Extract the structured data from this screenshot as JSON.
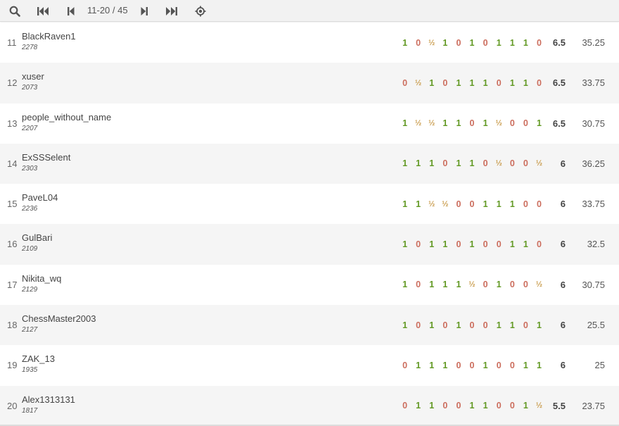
{
  "toolbar": {
    "page_indicator": "11-20 / 45",
    "icons": [
      "search-icon",
      "first-page-icon",
      "previous-page-icon",
      "next-page-icon",
      "last-page-icon",
      "locate-me-icon"
    ]
  },
  "colors": {
    "win": "#629924",
    "loss": "#cc6e5e",
    "draw": "#c99b4b"
  },
  "players": [
    {
      "rank": "11",
      "name": "BlackRaven1",
      "rating": "2278",
      "results": [
        "1",
        "0",
        "½",
        "1",
        "0",
        "1",
        "0",
        "1",
        "1",
        "1",
        "0"
      ],
      "score": "6.5",
      "tiebreak": "35.25"
    },
    {
      "rank": "12",
      "name": "xuser",
      "rating": "2073",
      "results": [
        "0",
        "½",
        "1",
        "0",
        "1",
        "1",
        "1",
        "0",
        "1",
        "1",
        "0"
      ],
      "score": "6.5",
      "tiebreak": "33.75"
    },
    {
      "rank": "13",
      "name": "people_without_name",
      "rating": "2207",
      "results": [
        "1",
        "½",
        "½",
        "1",
        "1",
        "0",
        "1",
        "½",
        "0",
        "0",
        "1"
      ],
      "score": "6.5",
      "tiebreak": "30.75"
    },
    {
      "rank": "14",
      "name": "ExSSSelent",
      "rating": "2303",
      "results": [
        "1",
        "1",
        "1",
        "0",
        "1",
        "1",
        "0",
        "½",
        "0",
        "0",
        "½"
      ],
      "score": "6",
      "tiebreak": "36.25"
    },
    {
      "rank": "15",
      "name": "PaveL04",
      "rating": "2236",
      "results": [
        "1",
        "1",
        "½",
        "½",
        "0",
        "0",
        "1",
        "1",
        "1",
        "0",
        "0"
      ],
      "score": "6",
      "tiebreak": "33.75"
    },
    {
      "rank": "16",
      "name": "GulBari",
      "rating": "2109",
      "results": [
        "1",
        "0",
        "1",
        "1",
        "0",
        "1",
        "0",
        "0",
        "1",
        "1",
        "0"
      ],
      "score": "6",
      "tiebreak": "32.5"
    },
    {
      "rank": "17",
      "name": "Nikita_wq",
      "rating": "2129",
      "results": [
        "1",
        "0",
        "1",
        "1",
        "1",
        "½",
        "0",
        "1",
        "0",
        "0",
        "½"
      ],
      "score": "6",
      "tiebreak": "30.75"
    },
    {
      "rank": "18",
      "name": "ChessMaster2003",
      "rating": "2127",
      "results": [
        "1",
        "0",
        "1",
        "0",
        "1",
        "0",
        "0",
        "1",
        "1",
        "0",
        "1"
      ],
      "score": "6",
      "tiebreak": "25.5"
    },
    {
      "rank": "19",
      "name": "ZAK_13",
      "rating": "1935",
      "results": [
        "0",
        "1",
        "1",
        "1",
        "0",
        "0",
        "1",
        "0",
        "0",
        "1",
        "1"
      ],
      "score": "6",
      "tiebreak": "25"
    },
    {
      "rank": "20",
      "name": "Alex1313131",
      "rating": "1817",
      "results": [
        "0",
        "1",
        "1",
        "0",
        "0",
        "1",
        "1",
        "0",
        "0",
        "1",
        "½"
      ],
      "score": "5.5",
      "tiebreak": "23.75"
    }
  ]
}
